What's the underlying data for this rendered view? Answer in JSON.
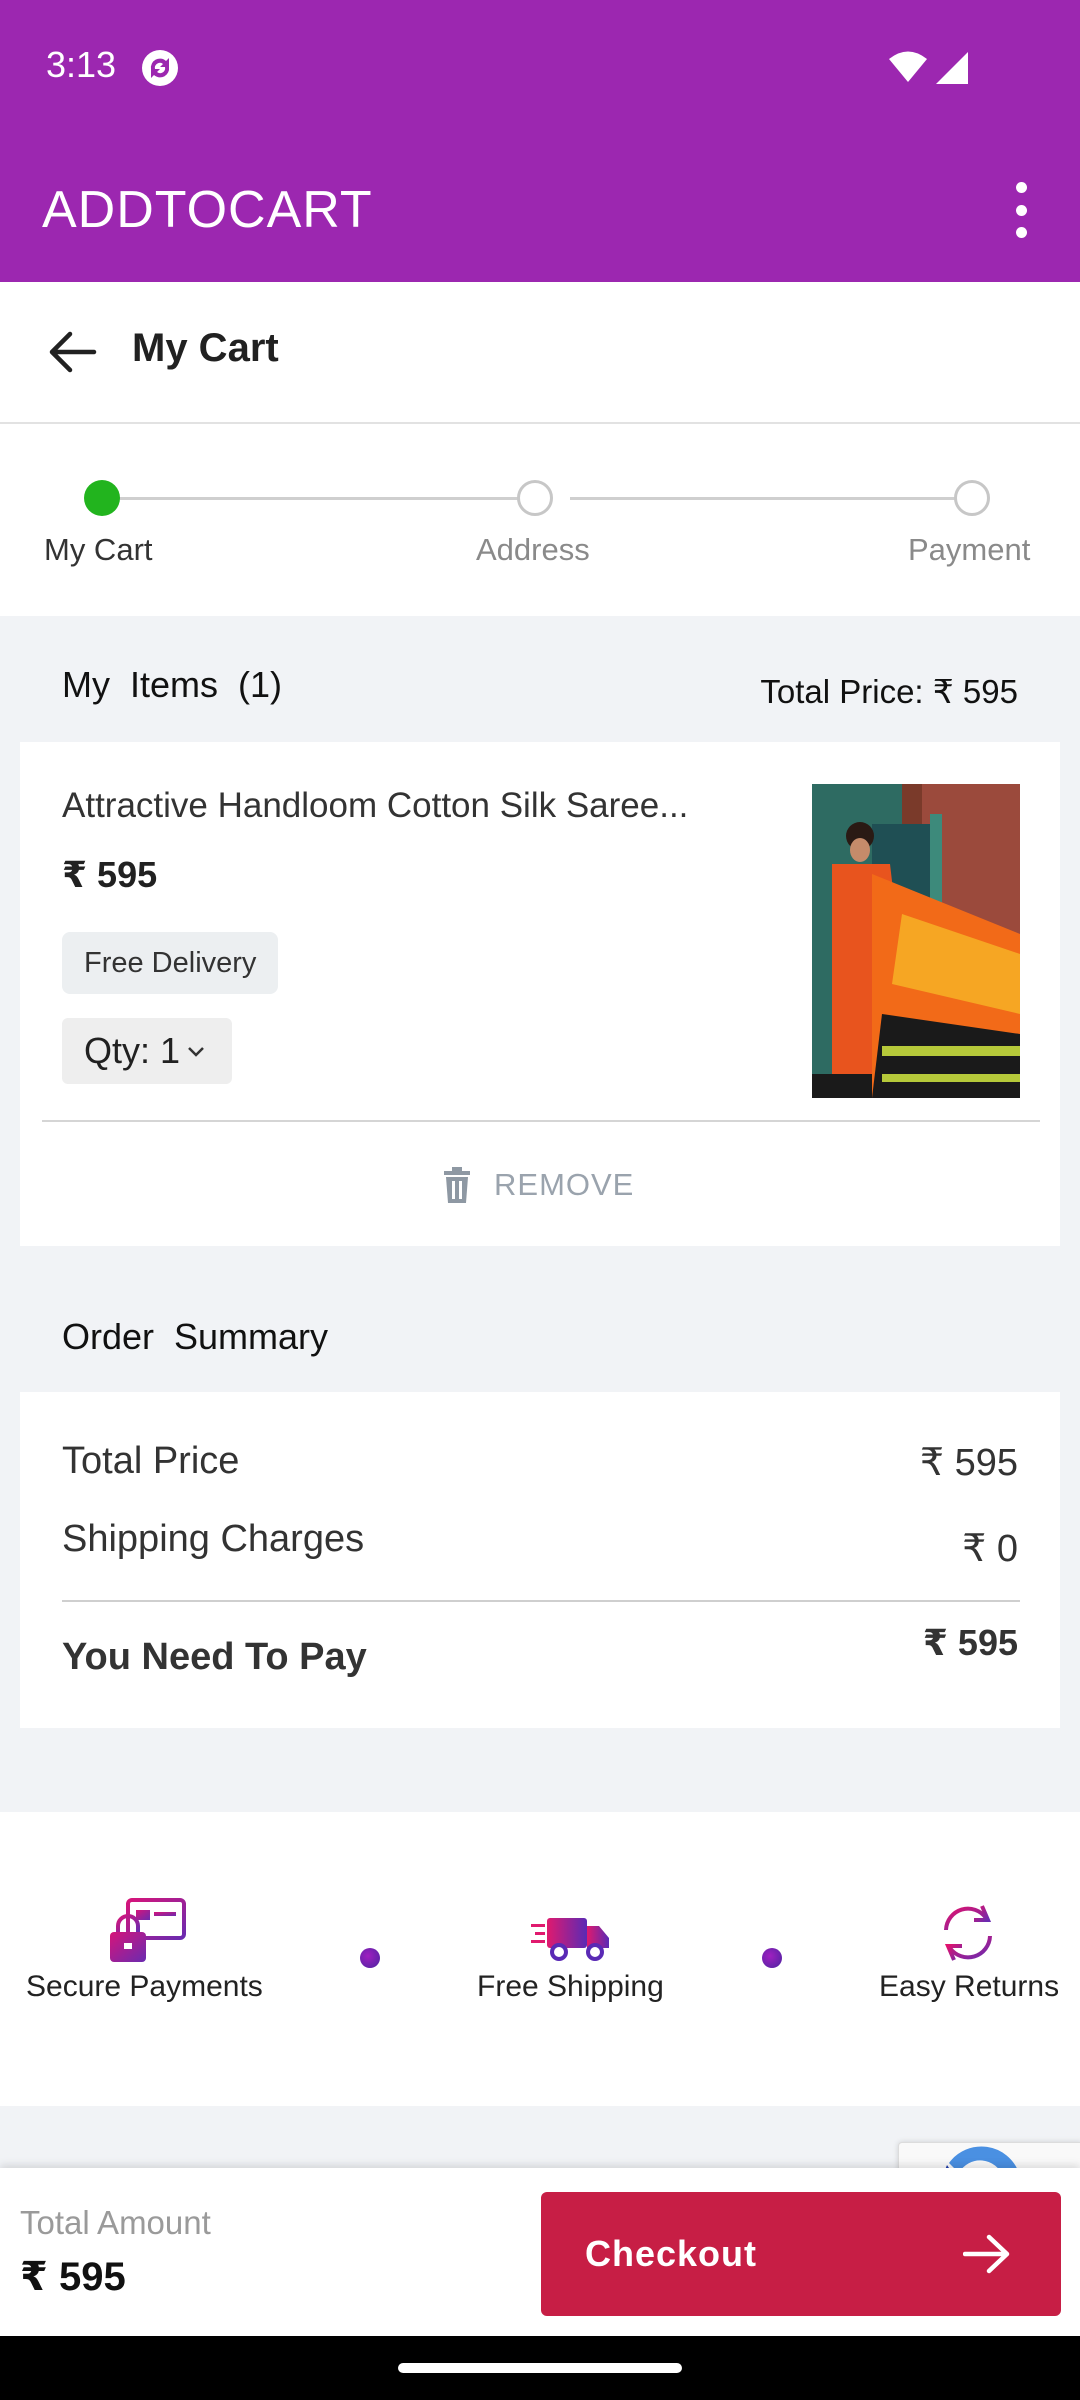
{
  "status_bar": {
    "time": "3:13"
  },
  "app_bar": {
    "title": "ADDTOCART"
  },
  "header": {
    "title": "My Cart"
  },
  "stepper": {
    "steps": [
      {
        "label": "My Cart",
        "state": "active"
      },
      {
        "label": "Address",
        "state": "pending"
      },
      {
        "label": "Payment",
        "state": "pending"
      }
    ]
  },
  "items_section": {
    "title": "My  Items  (1)",
    "total_price": "Total Price: ₹ 595"
  },
  "product": {
    "name": "Attractive Handloom Cotton Silk Saree...",
    "price": "₹ 595",
    "badge": "Free Delivery",
    "qty": "Qty: 1",
    "remove_label": "REMOVE"
  },
  "order_summary": {
    "title": "Order  Summary",
    "total_price_label": "Total Price",
    "total_price_value": "₹ 595",
    "shipping_label": "Shipping Charges",
    "shipping_value": "₹ 0",
    "pay_label": "You Need To Pay",
    "pay_value": "₹ 595"
  },
  "trust": [
    {
      "label": "Secure Payments",
      "icon": "secure-payment-icon"
    },
    {
      "label": "Free Shipping",
      "icon": "delivery-truck-icon"
    },
    {
      "label": "Easy Returns",
      "icon": "returns-icon"
    }
  ],
  "bottom_bar": {
    "total_label": "Total Amount",
    "total_value": "₹ 595",
    "checkout_label": "Checkout"
  },
  "colors": {
    "app_bar": "#9c27b0",
    "checkout": "#c71e45",
    "step_active": "#22b41e"
  }
}
